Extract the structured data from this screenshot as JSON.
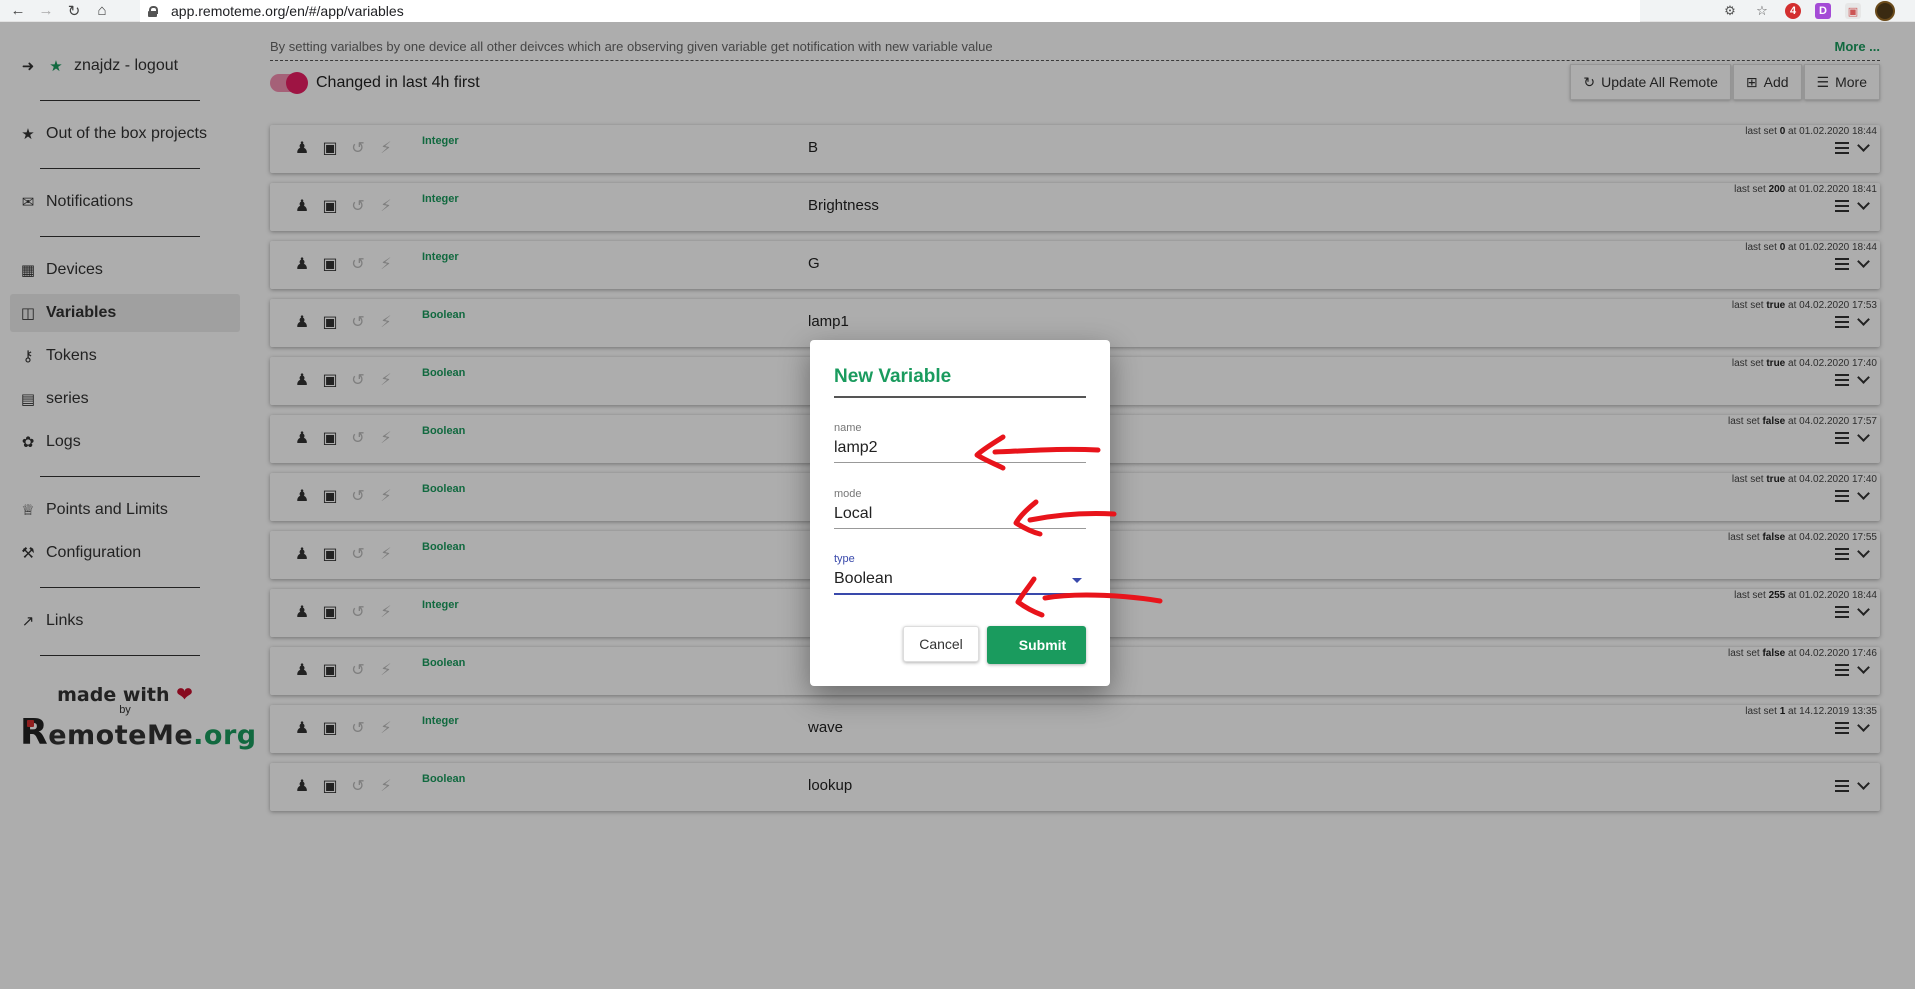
{
  "browser": {
    "url": "app.remoteme.org/en/#/app/variables",
    "ext_badge": "4",
    "ext_d": "D"
  },
  "sidebar": {
    "items": [
      {
        "label": "znajdz - logout",
        "icon": "logout-icon"
      },
      {
        "label": "Out of the box projects",
        "icon": "star-icon"
      },
      {
        "label": "Notifications",
        "icon": "envelope-icon"
      },
      {
        "label": "Devices",
        "icon": "chip-icon"
      },
      {
        "label": "Variables",
        "icon": "variable-file-icon"
      },
      {
        "label": "Tokens",
        "icon": "key-icon"
      },
      {
        "label": "series",
        "icon": "bar-chart-icon"
      },
      {
        "label": "Logs",
        "icon": "bug-icon"
      },
      {
        "label": "Points and Limits",
        "icon": "trophy-icon"
      },
      {
        "label": "Configuration",
        "icon": "wrench-icon"
      },
      {
        "label": "Links",
        "icon": "external-link-icon"
      }
    ],
    "made_with": "made with",
    "by": "by",
    "logo_r": "R",
    "logo_main": "emoteMe",
    "logo_org": ".org"
  },
  "main": {
    "info": "By setting varialbes by one device all other deivces which are observing given variable get notification with new variable value",
    "more_link": "More ...",
    "toggle_label": "Changed in last 4h first",
    "toolbar": {
      "update": "Update All Remote",
      "add": "Add",
      "more": "More"
    },
    "rows": [
      {
        "type": "Integer",
        "name": "B",
        "pre": "last set ",
        "val": "0",
        "post": " at 01.02.2020 18:44"
      },
      {
        "type": "Integer",
        "name": "Brightness",
        "pre": "last set ",
        "val": "200",
        "post": " at 01.02.2020 18:41"
      },
      {
        "type": "Integer",
        "name": "G",
        "pre": "last set ",
        "val": "0",
        "post": " at 01.02.2020 18:44"
      },
      {
        "type": "Boolean",
        "name": "lamp1",
        "pre": "last set ",
        "val": "true",
        "post": " at 04.02.2020 17:53"
      },
      {
        "type": "Boolean",
        "name": "",
        "pre": "last set ",
        "val": "true",
        "post": " at 04.02.2020 17:40"
      },
      {
        "type": "Boolean",
        "name": "",
        "pre": "last set ",
        "val": "false",
        "post": " at 04.02.2020 17:57"
      },
      {
        "type": "Boolean",
        "name": "",
        "pre": "last set ",
        "val": "true",
        "post": " at 04.02.2020 17:40"
      },
      {
        "type": "Boolean",
        "name": "",
        "pre": "last set ",
        "val": "false",
        "post": " at 04.02.2020 17:55"
      },
      {
        "type": "Integer",
        "name": "",
        "pre": "last set ",
        "val": "255",
        "post": " at 01.02.2020 18:44"
      },
      {
        "type": "Boolean",
        "name": "",
        "pre": "last set ",
        "val": "false",
        "post": " at 04.02.2020 17:46"
      },
      {
        "type": "Integer",
        "name": "wave",
        "pre": "last set ",
        "val": "1",
        "post": " at 14.12.2019 13:35"
      },
      {
        "type": "Boolean",
        "name": "lookup",
        "pre": "",
        "val": "",
        "post": ""
      }
    ]
  },
  "dialog": {
    "title": "New Variable",
    "name_label": "name",
    "name_value": "lamp2",
    "mode_label": "mode",
    "mode_value": "Local",
    "type_label": "type",
    "type_value": "Boolean",
    "cancel": "Cancel",
    "submit": "Submit"
  },
  "colors": {
    "accent": "#1a9b5e",
    "toggle": "#e91e63",
    "focus": "#3949ab",
    "annotation": "#e8141b"
  }
}
